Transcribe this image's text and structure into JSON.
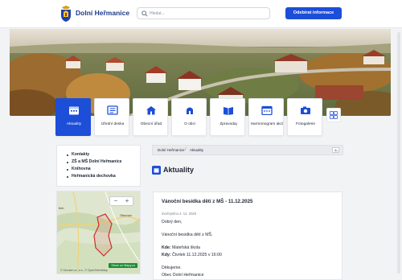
{
  "header": {
    "brand": "Dolní Heřmanice",
    "search_placeholder": "Hledat...",
    "subscribe_label": "Odebírat informace"
  },
  "tiles": [
    {
      "label": "Aktuality",
      "icon": "calendar-icon",
      "active": true
    },
    {
      "label": "Úřední deska",
      "icon": "notice-board-icon",
      "active": false
    },
    {
      "label": "Obecní úřad",
      "icon": "town-hall-icon",
      "active": false
    },
    {
      "label": "O obci",
      "icon": "village-icon",
      "active": false
    },
    {
      "label": "Zpravodaj",
      "icon": "newsletter-icon",
      "active": false
    },
    {
      "label": "Harmonogram akcí",
      "icon": "schedule-icon",
      "active": false
    },
    {
      "label": "Fotogalerie",
      "icon": "gallery-icon",
      "active": false
    }
  ],
  "sidebar": {
    "links": [
      "Kontakty",
      "ZŠ a MŠ Dolní Heřmanice",
      "Knihovna",
      "Heřmanická dechovka"
    ]
  },
  "map": {
    "label_left": "řich",
    "label_right": "Otecnov",
    "badge": "Show on Mapy.cz",
    "attribution": "© Seznam.cz, a.s., © OpenStreetMap"
  },
  "breadcrumb": [
    "Dolní Heřmanice",
    "Aktuality"
  ],
  "page_title": "Aktuality",
  "article": {
    "title": "Vánoční besídka dětí z MŠ - 11.12.2025",
    "date": "Zveřejněno 4. 12. 2025",
    "greeting": "Dobrý den,",
    "intro": "Vánoční besídka dětí z MŠ.",
    "where_label": "Kde:",
    "where_value": "Mateřská škola",
    "when_label": "Kdy:",
    "when_value": "Čtvrtek 11.12.2025 v 16:00",
    "closing": "Děkujeme.",
    "signature": "Obec Dolní Heřmanice"
  },
  "colors": {
    "primary": "#1d4ed8",
    "brand_text": "#1e3a8a"
  }
}
